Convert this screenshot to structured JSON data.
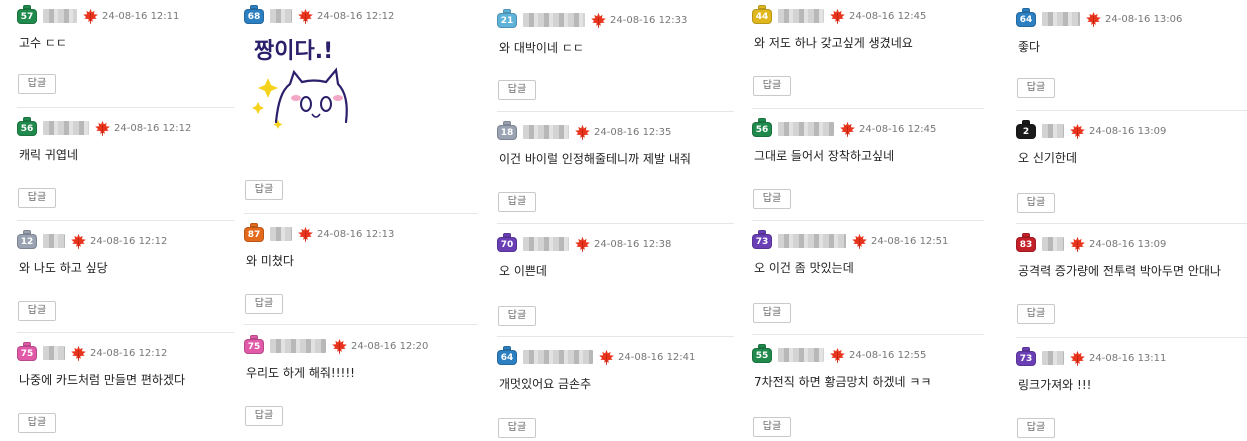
{
  "reply_label": "답글",
  "leaf_icon": "maple-leaf-icon",
  "columns": [
    {
      "comments": [
        {
          "level": "57",
          "badge_color": "#1f8a4c",
          "date": "24-08-16 12:11",
          "text": "고수 ㄷㄷ"
        },
        {
          "level": "56",
          "badge_color": "#1f8a4c",
          "date": "24-08-16 12:12",
          "text": "캐릭 귀엽네"
        },
        {
          "level": "12",
          "badge_color": "#9aa3b2",
          "date": "24-08-16 12:12",
          "text": "와 나도 하고 싶당"
        },
        {
          "level": "75",
          "badge_color": "#e05aa8",
          "date": "24-08-16 12:12",
          "text": "나중에 카드처럼 만들면 편하겠다"
        }
      ]
    },
    {
      "comments": [
        {
          "level": "68",
          "badge_color": "#2c7fc0",
          "date": "24-08-16 12:12",
          "text": "",
          "sticker": {
            "text": "짱이다.!",
            "name": "cute-cat-sticker"
          }
        },
        {
          "level": "87",
          "badge_color": "#e36a1c",
          "date": "24-08-16 12:13",
          "text": "와 미쳤다"
        },
        {
          "level": "75",
          "badge_color": "#e05aa8",
          "date": "24-08-16 12:20",
          "text": "우리도 하게 해줘!!!!!"
        }
      ]
    },
    {
      "comments": [
        {
          "level": "21",
          "badge_color": "#5fb3d9",
          "date": "24-08-16 12:33",
          "text": "와 대박이네 ㄷㄷ"
        },
        {
          "level": "18",
          "badge_color": "#9aa3b2",
          "date": "24-08-16 12:35",
          "text": "이건 바이럴 인정해줄테니까 제발 내줘"
        },
        {
          "level": "70",
          "badge_color": "#6a3fb5",
          "date": "24-08-16 12:38",
          "text": "오 이쁜데"
        },
        {
          "level": "64",
          "badge_color": "#2c7fc0",
          "date": "24-08-16 12:41",
          "text": "개멋있어요 금손추"
        }
      ]
    },
    {
      "comments": [
        {
          "level": "44",
          "badge_color": "#e0b81e",
          "date": "24-08-16 12:45",
          "text": "와 저도 하나 갖고싶게 생겼네요"
        },
        {
          "level": "56",
          "badge_color": "#1f8a4c",
          "date": "24-08-16 12:45",
          "text": "그대로 들어서 장착하고싶네"
        },
        {
          "level": "73",
          "badge_color": "#6a3fb5",
          "date": "24-08-16 12:51",
          "text": "오 이건 좀 맛있는데"
        },
        {
          "level": "55",
          "badge_color": "#1f8a4c",
          "date": "24-08-16 12:55",
          "text": "7차전직 하면 황금망치 하겠네 ㅋㅋ"
        }
      ]
    },
    {
      "comments": [
        {
          "level": "64",
          "badge_color": "#2c7fc0",
          "date": "24-08-16 13:06",
          "text": "좋다"
        },
        {
          "level": "2",
          "badge_color": "#1a1a1a",
          "date": "24-08-16 13:09",
          "text": "오 신기한데"
        },
        {
          "level": "83",
          "badge_color": "#c4202a",
          "date": "24-08-16 13:09",
          "text": "공격력 증가량에 전투력 박아두면 안대나"
        },
        {
          "level": "73",
          "badge_color": "#6a3fb5",
          "date": "24-08-16 13:11",
          "text": "링크가져와 !!!"
        }
      ]
    }
  ]
}
